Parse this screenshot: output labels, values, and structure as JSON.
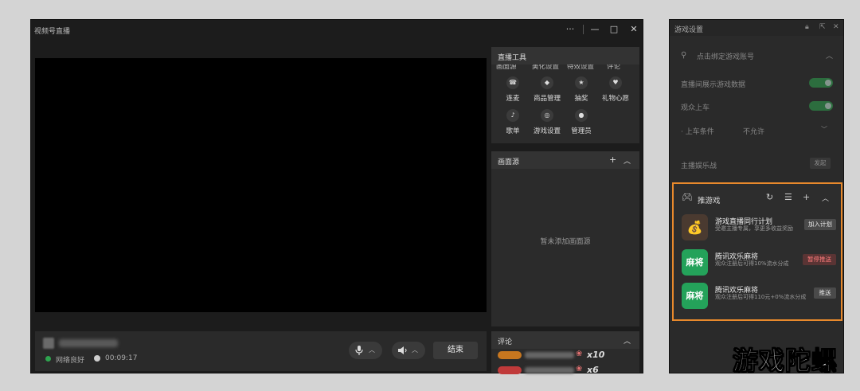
{
  "main_window": {
    "title": "视频号直播",
    "controls": {
      "more": "···",
      "minimize": "—",
      "maximize": "□",
      "close": "✕"
    }
  },
  "bottom_bar": {
    "network_status": "网络良好",
    "duration": "00:09:17",
    "mic_icon": "mic-icon",
    "speaker_icon": "speaker-icon",
    "end_label": "结束"
  },
  "tools_panel": {
    "title": "直播工具",
    "cut_row": [
      "画面源",
      "美化设置",
      "特效设置",
      "评论"
    ],
    "items": [
      {
        "label": "连麦",
        "icon": "link-mic-icon"
      },
      {
        "label": "商品管理",
        "icon": "goods-icon"
      },
      {
        "label": "抽奖",
        "icon": "lottery-icon"
      },
      {
        "label": "礼物心愿",
        "icon": "gift-wish-icon"
      },
      {
        "label": "歌单",
        "icon": "playlist-icon"
      },
      {
        "label": "游戏设置",
        "icon": "gamepad-icon"
      },
      {
        "label": "管理员",
        "icon": "admin-icon"
      }
    ]
  },
  "source_panel": {
    "title": "画面源",
    "empty_text": "暂未添加画面源"
  },
  "comment_panel": {
    "title": "评论",
    "rows": [
      {
        "count": "x10",
        "badge_color": "#c8771f"
      },
      {
        "count": "x6",
        "badge_color": "#c03a3a"
      }
    ]
  },
  "game_settings": {
    "title": "游戏设置",
    "bind_account": "点击绑定游戏账号",
    "show_game_data": "直播间展示游戏数据",
    "audience_join": "观众上车",
    "join_condition_label": "· 上车条件",
    "join_condition_value": "不允许",
    "host_fun_battle": "主播娱乐战",
    "host_fun_battle_btn": "发起",
    "push_game": {
      "title": "推游戏",
      "items": [
        {
          "name": "游戏直播同行计划",
          "desc": "受邀主播专属，享更多收益奖励",
          "button": "加入计划",
          "btn_bg": "#4a4a4a",
          "btn_fg": "#e6e6e6",
          "thumb_color": "#4a3a30",
          "thumb_text": "💰"
        },
        {
          "name": "腾讯欢乐麻将",
          "desc": "观众注册后可得10%流水分成",
          "button": "暂停推送",
          "btn_bg": "#5a3434",
          "btn_fg": "#ff7b7b",
          "thumb_color": "#24a25a",
          "thumb_text": "麻将"
        },
        {
          "name": "腾讯欢乐麻将",
          "desc": "观众注册后可得110元+0%流水分成",
          "button": "推送",
          "btn_bg": "#4a4a4a",
          "btn_fg": "#e6e6e6",
          "thumb_color": "#24a25a",
          "thumb_text": "麻将"
        }
      ]
    }
  },
  "watermark": "游戏陀螺",
  "colors": {
    "accent_green": "#2ea44f",
    "highlight_orange": "#e8892c"
  }
}
